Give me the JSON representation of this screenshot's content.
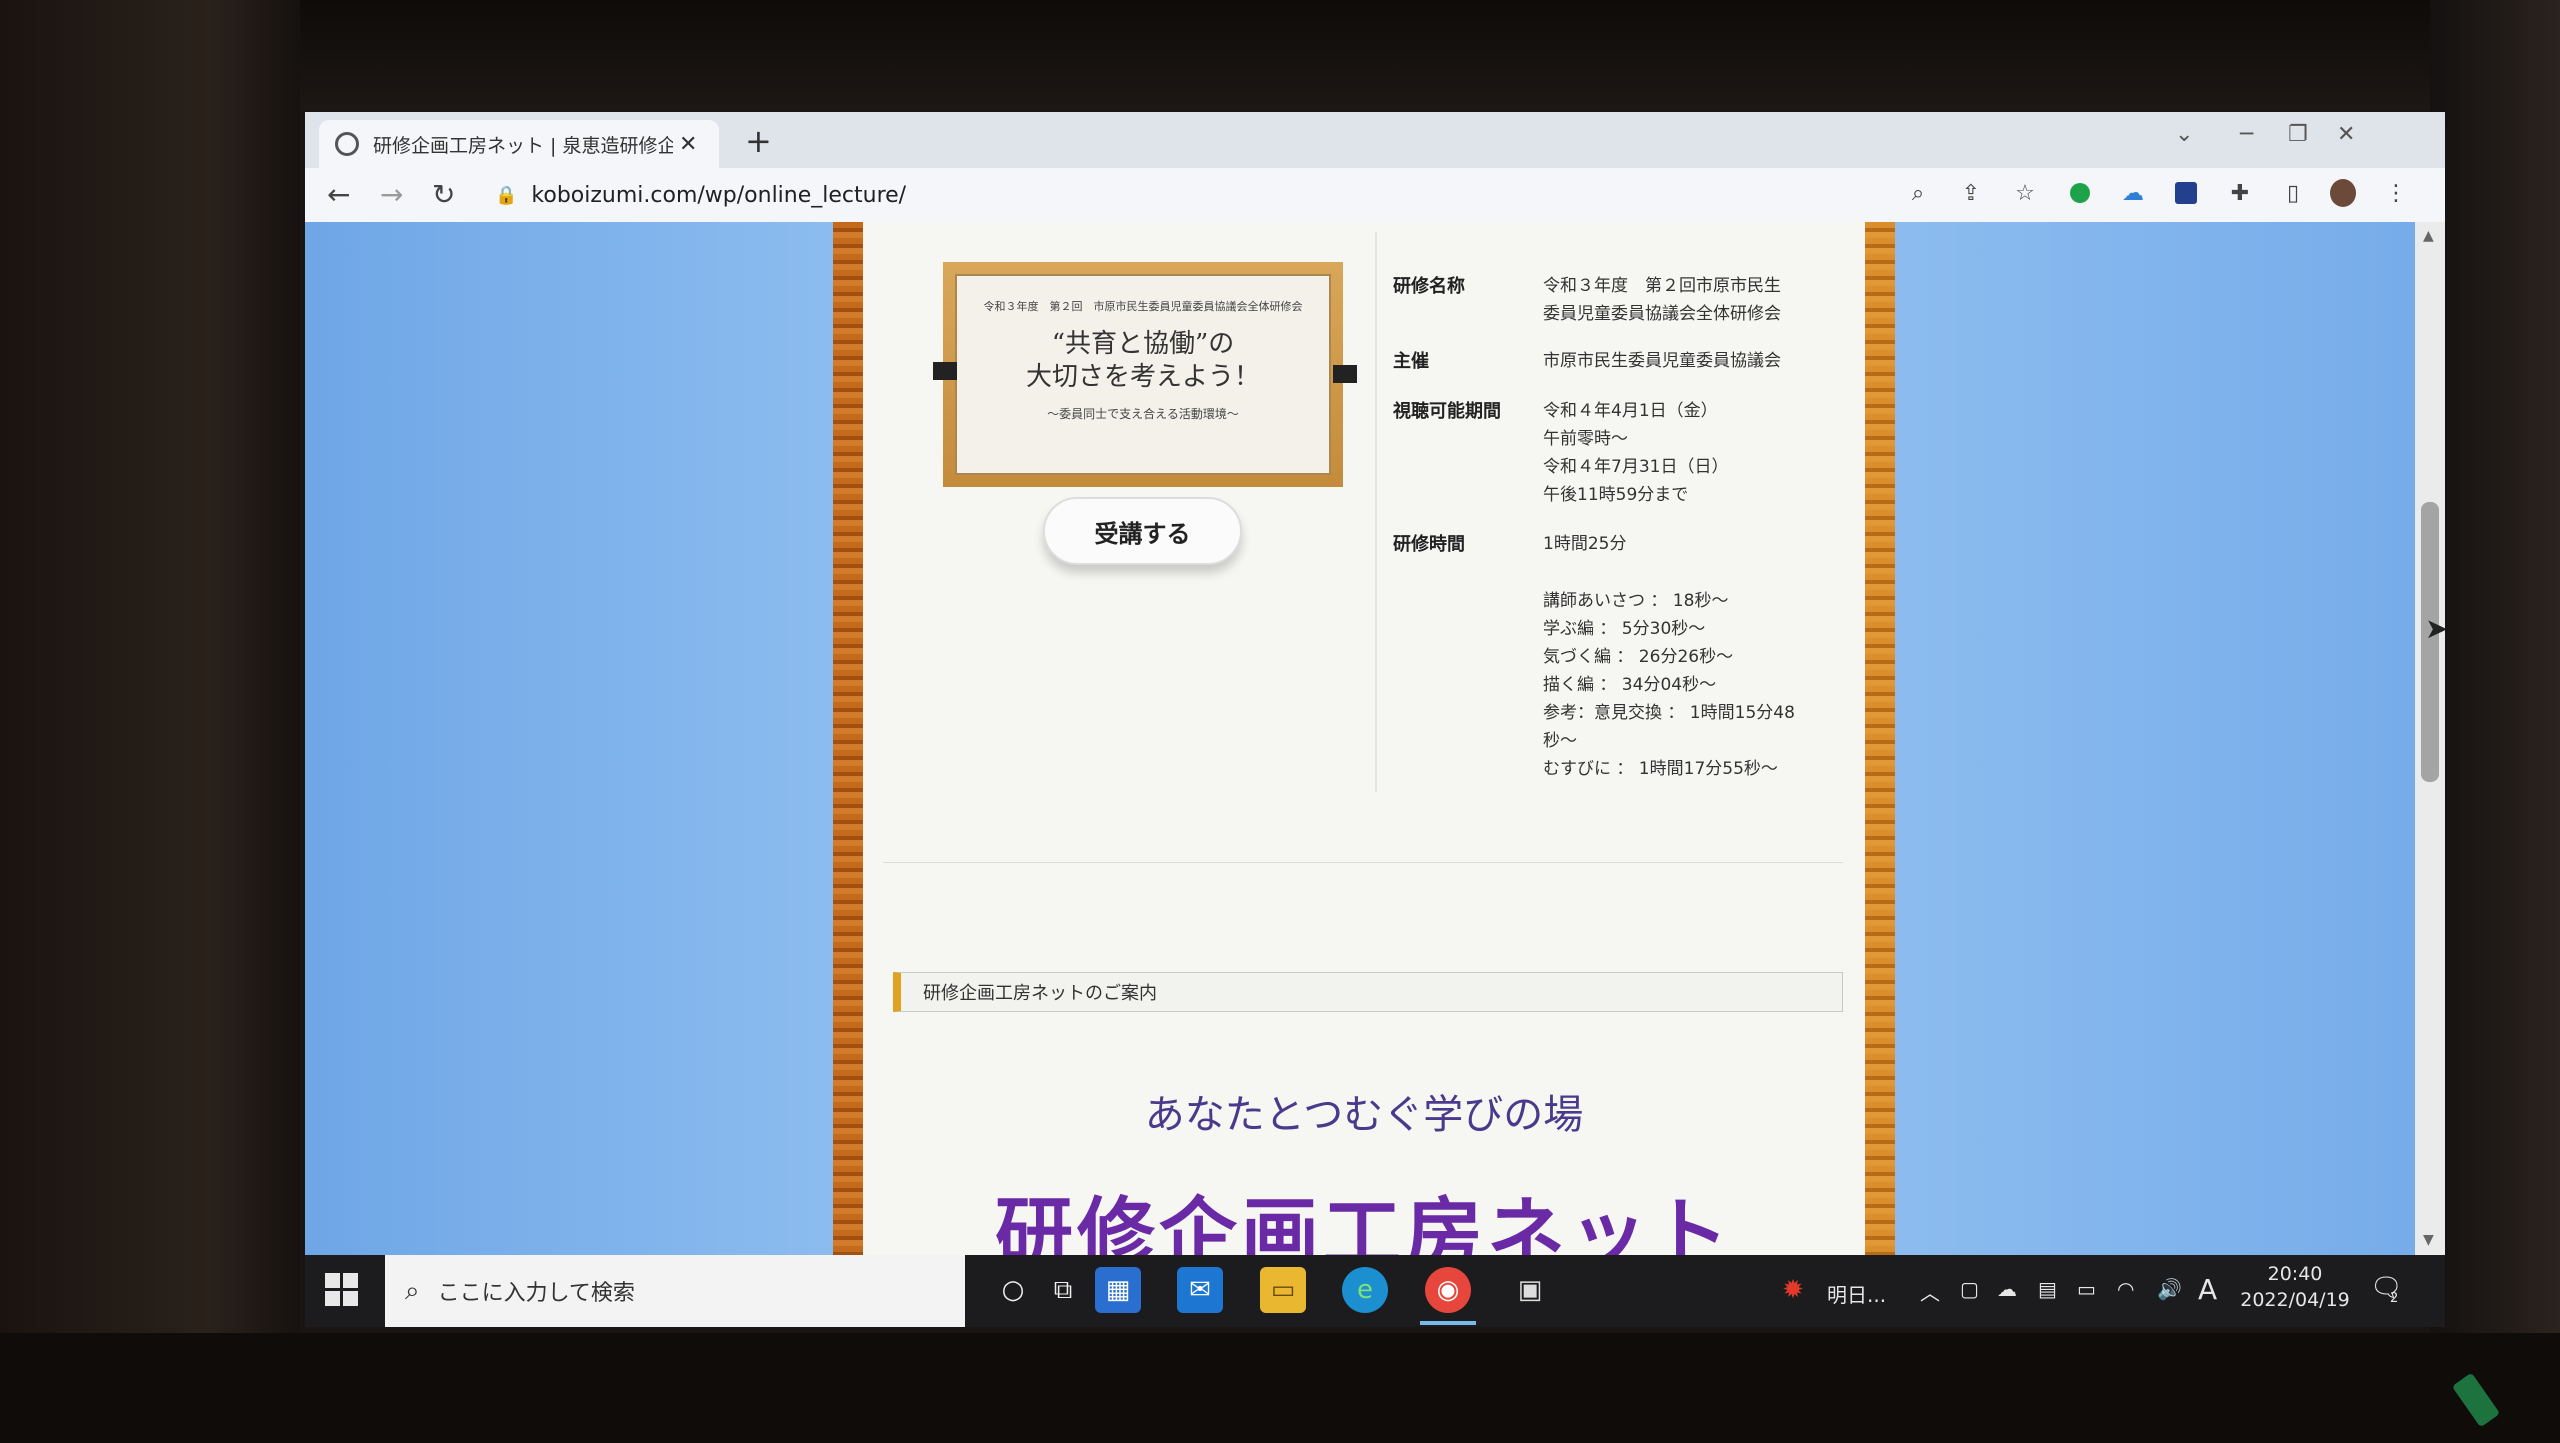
{
  "browser": {
    "tab_title": "研修企画工房ネット | 泉恵造研修企画",
    "tab_close": "✕",
    "new_tab": "+",
    "url": "koboizumi.com/wp/online_lecture/"
  },
  "poster": {
    "header": "令和３年度　第２回　市原市民生委員児童委員協議会全体研修会",
    "title_line1": "“共育と協働”の",
    "title_line2": "大切さを考えよう！",
    "subtitle": "〜委員同士で支え合える活動環境〜"
  },
  "enroll_button": "受講する",
  "details": {
    "course_name_label": "研修名称",
    "course_name_value_1": "令和３年度　第２回市原市民生",
    "course_name_value_2": "委員児童委員協議会全体研修会",
    "organizer_label": "主催",
    "organizer_value": "市原市民生委員児童委員協議会",
    "period_label": "視聴可能期間",
    "period_1": "令和４年4月1日（金）",
    "period_2": "午前零時〜",
    "period_3": "令和４年7月31日（日）",
    "period_4": "午後11時59分まで",
    "duration_label": "研修時間",
    "duration_value": "1時間25分",
    "chapters": [
      "講師あいさつ ： 18秒〜",
      "学ぶ編 ： 5分30秒〜",
      "気づく編 ： 26分26秒〜",
      "描く編 ： 34分04秒〜",
      "参考：意見交換 ： 1時間15分48",
      "秒〜",
      "むすびに ： 1時間17分55秒〜"
    ]
  },
  "section_heading": "研修企画工房ネットのご案内",
  "tagline": "あなたとつむぐ学びの場",
  "site_title": "研修企画工房ネット",
  "taskbar": {
    "search_placeholder": "ここに入力して検索",
    "weather_text": "明日...",
    "ime": "A",
    "time": "20:40",
    "date": "2022/04/19",
    "notification_count": "2"
  }
}
